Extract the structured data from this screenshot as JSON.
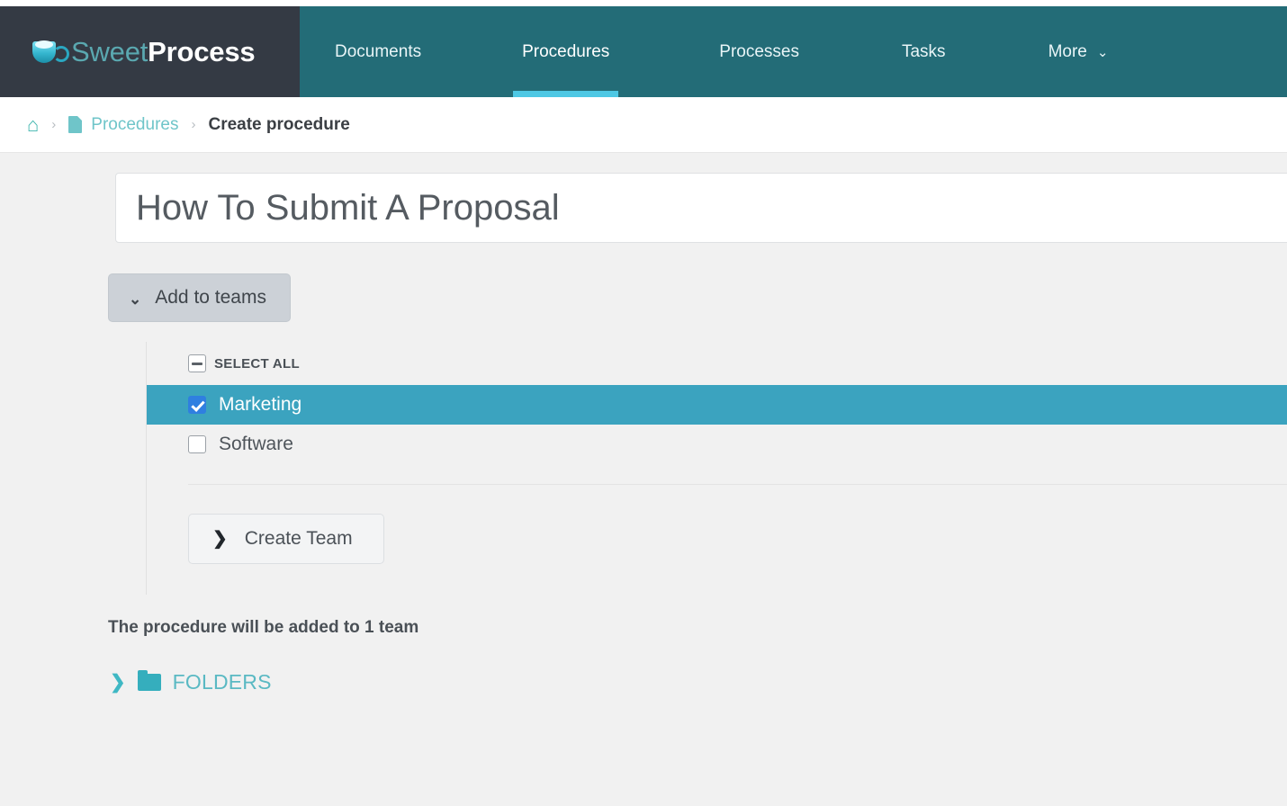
{
  "brand": {
    "name_light": "Sweet",
    "name_bold": "Process",
    "icon": "coffee-cup-icon"
  },
  "nav": {
    "items": [
      {
        "label": "Documents",
        "active": false
      },
      {
        "label": "Procedures",
        "active": true
      },
      {
        "label": "Processes",
        "active": false
      },
      {
        "label": "Tasks",
        "active": false
      },
      {
        "label": "More",
        "active": false,
        "caret": "⌄"
      }
    ],
    "active_accent_color": "#4ec8e4",
    "bar_color": "#236c77",
    "brand_panel_color": "#343a44"
  },
  "breadcrumb": {
    "home_icon": "⌂",
    "separator": "›",
    "doc_icon": "document-icon",
    "link_label": "Procedures",
    "current_label": "Create procedure",
    "link_color": "#6fc5c9"
  },
  "main": {
    "title_value": "How To Submit A Proposal",
    "title_placeholder": "Title",
    "add_to_teams": {
      "label": "Add to teams",
      "caret": "⌄"
    },
    "teams": {
      "select_all_label": "SELECT ALL",
      "select_all_state": "indeterminate",
      "rows": [
        {
          "name": "Marketing",
          "checked": true,
          "highlighted": true
        },
        {
          "name": "Software",
          "checked": false,
          "highlighted": false
        }
      ],
      "highlight_color": "#3ba3bf",
      "checked_color": "#2f7fe0"
    },
    "create_team": {
      "label": "Create Team",
      "caret": "❯"
    },
    "summary": "The procedure will be added to 1 team",
    "folders": {
      "caret": "❯",
      "icon": "folder-icon",
      "label": "FOLDERS",
      "color": "#5ab9c3"
    }
  }
}
